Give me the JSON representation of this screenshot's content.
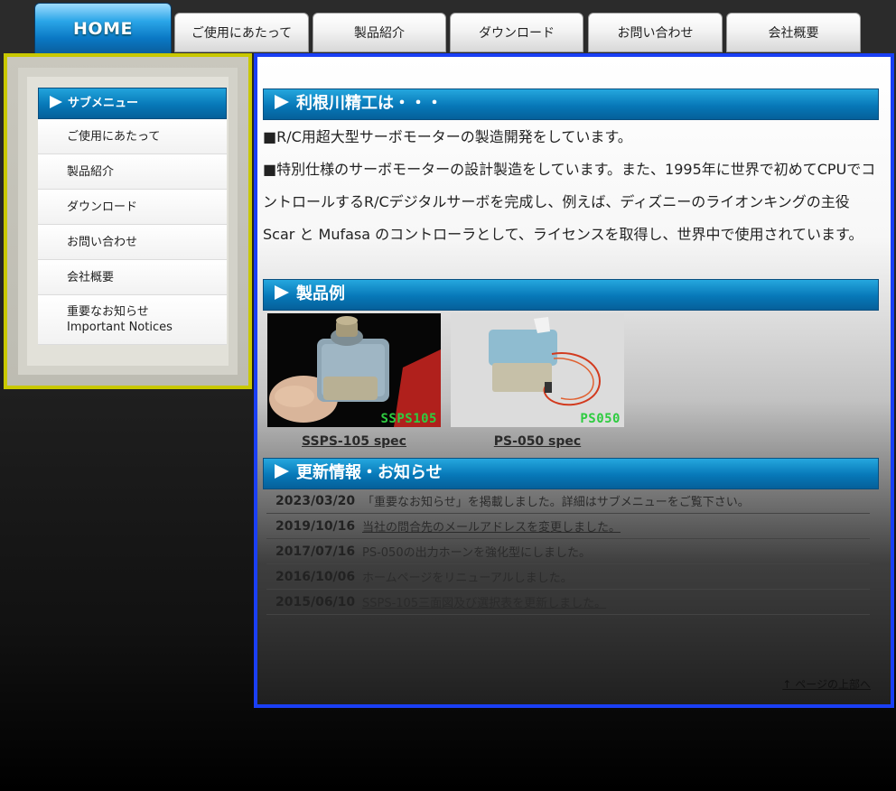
{
  "nav": {
    "home": "HOME",
    "tabs": [
      "ご使用にあたって",
      "製品紹介",
      "ダウンロード",
      "お問い合わせ",
      "会社概要"
    ]
  },
  "sidebar": {
    "title": "サブメニュー",
    "items": [
      {
        "label": "ご使用にあたって"
      },
      {
        "label": "製品紹介"
      },
      {
        "label": "ダウンロード"
      },
      {
        "label": "お問い合わせ"
      },
      {
        "label": "会社概要"
      },
      {
        "label": "重要なお知らせ",
        "sublabel": "Important Notices"
      }
    ]
  },
  "main": {
    "about_heading": "利根川精工は・・・",
    "para1": "■R/C用超大型サーボモーターの製造開発をしています。",
    "para2": "■特別仕様のサーボモーターの設計製造をしています。また、1995年に世界で初めてCPUでコントロールするR/Cデジタルサーボを完成し、例えば、ディズニーのライオンキングの主役Scar と Mufasa のコントローラとして、ライセンスを取得し、世界中で使用されています。",
    "products_heading": "製品例",
    "products": [
      {
        "label": "SSPS105",
        "caption": "SSPS-105 spec"
      },
      {
        "label": "PS050",
        "caption": "PS-050 spec"
      }
    ],
    "news_heading": "更新情報・お知らせ",
    "news": [
      {
        "date": "2023/03/20",
        "text": "「重要なお知らせ」を掲載しました。詳細はサブメニューをご覧下さい。"
      },
      {
        "date": "2019/10/16",
        "text": "当社の問合先のメールアドレスを変更しました。"
      },
      {
        "date": "2017/07/16",
        "text": "PS-050の出力ホーンを強化型にしました。"
      },
      {
        "date": "2016/10/06",
        "text": "ホームページをリニューアルしました。"
      },
      {
        "date": "2015/06/10",
        "text": "SSPS-105三面図及び選択表を更新しました。"
      }
    ],
    "page_top": "↑ ページの上部へ"
  }
}
